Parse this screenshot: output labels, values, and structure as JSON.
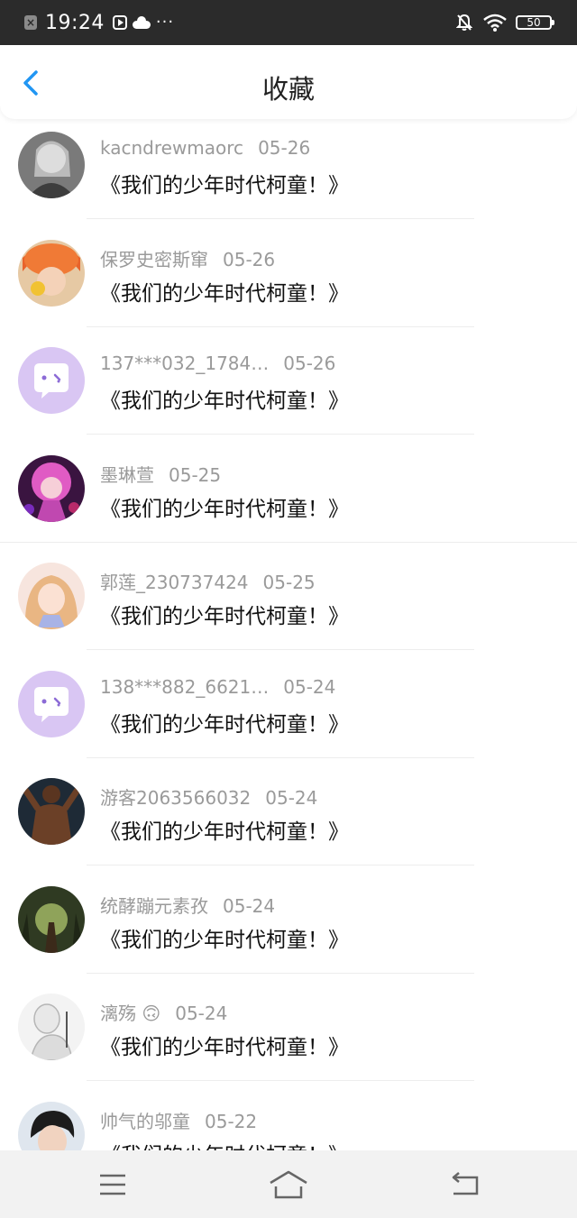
{
  "status_bar": {
    "time": "19:24",
    "battery": "50"
  },
  "header": {
    "title": "收藏"
  },
  "items": [
    {
      "user": "kacndrewmaorc",
      "date": "05-26",
      "title": "《我们的少年时代柯童！》"
    },
    {
      "user": "保罗史密斯窜",
      "date": "05-26",
      "title": "《我们的少年时代柯童！》"
    },
    {
      "user": "137***032_1784…",
      "date": "05-26",
      "title": "《我们的少年时代柯童！》"
    },
    {
      "user": "墨琳萱",
      "date": "05-25",
      "title": "《我们的少年时代柯童！》"
    },
    {
      "user": "郭莲_230737424",
      "date": "05-25",
      "title": "《我们的少年时代柯童！》"
    },
    {
      "user": "138***882_6621…",
      "date": "05-24",
      "title": "《我们的少年时代柯童！》"
    },
    {
      "user": "游客2063566032",
      "date": "05-24",
      "title": "《我们的少年时代柯童！》"
    },
    {
      "user": "统酵蹦元素孜",
      "date": "05-24",
      "title": "《我们的少年时代柯童！》"
    },
    {
      "user": "漓殇 🙃",
      "date": "05-24",
      "title": "《我们的少年时代柯童！》"
    },
    {
      "user": "帅气的邬童",
      "date": "05-22",
      "title": "《我们的少年时代柯童！》"
    }
  ],
  "colors": {
    "accent": "#2196f3",
    "status_bar": "#2b2b2b",
    "default_avatar": "#d9c6f3"
  }
}
